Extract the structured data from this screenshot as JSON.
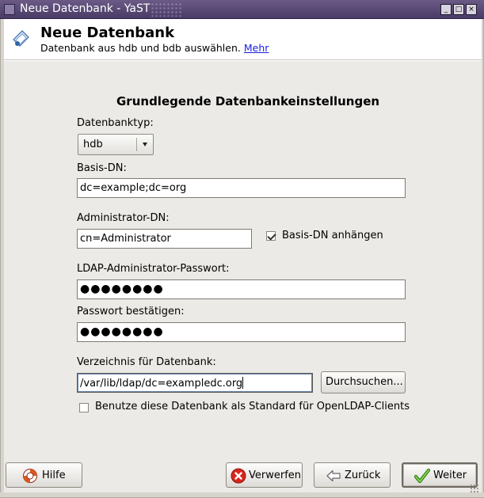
{
  "window": {
    "title": "Neue Datenbank - YaST",
    "controls": {
      "minimize": "_",
      "maximize": "□",
      "close": "×"
    }
  },
  "header": {
    "title": "Neue Datenbank",
    "subtitle": "Datenbank aus hdb und bdb auswählen.",
    "more_link": "Mehr",
    "icon": "ldap-database-icon"
  },
  "form": {
    "section_title": "Grundlegende Datenbankeinstellungen",
    "db_type": {
      "label": "Datenbanktyp:",
      "value": "hdb"
    },
    "base_dn": {
      "label": "Basis-DN:",
      "value": "dc=example;dc=org"
    },
    "admin_dn": {
      "label": "Administrator-DN:",
      "value": "cn=Administrator",
      "append_label": "Basis-DN anhängen",
      "append_checked": true
    },
    "password": {
      "label": "LDAP-Administrator-Passwort:",
      "value": "●●●●●●●●"
    },
    "password_confirm": {
      "label": "Passwort bestätigen:",
      "value": "●●●●●●●●"
    },
    "directory": {
      "label": "Verzeichnis für Datenbank:",
      "value": "/var/lib/ldap/dc=exampledc.org",
      "browse_label": "Durchsuchen..."
    },
    "default_client": {
      "label": "Benutze diese Datenbank als Standard für OpenLDAP-Clients",
      "checked": false
    }
  },
  "footer": {
    "help_label": "Hilfe",
    "discard_label": "Verwerfen",
    "back_label": "Zurück",
    "next_label": "Weiter"
  },
  "colors": {
    "titlebar": "#4a3c66",
    "panel": "#ebeae6",
    "link": "#1a1ae0",
    "discard_icon": "#d7261d",
    "next_icon": "#4fa52b"
  }
}
